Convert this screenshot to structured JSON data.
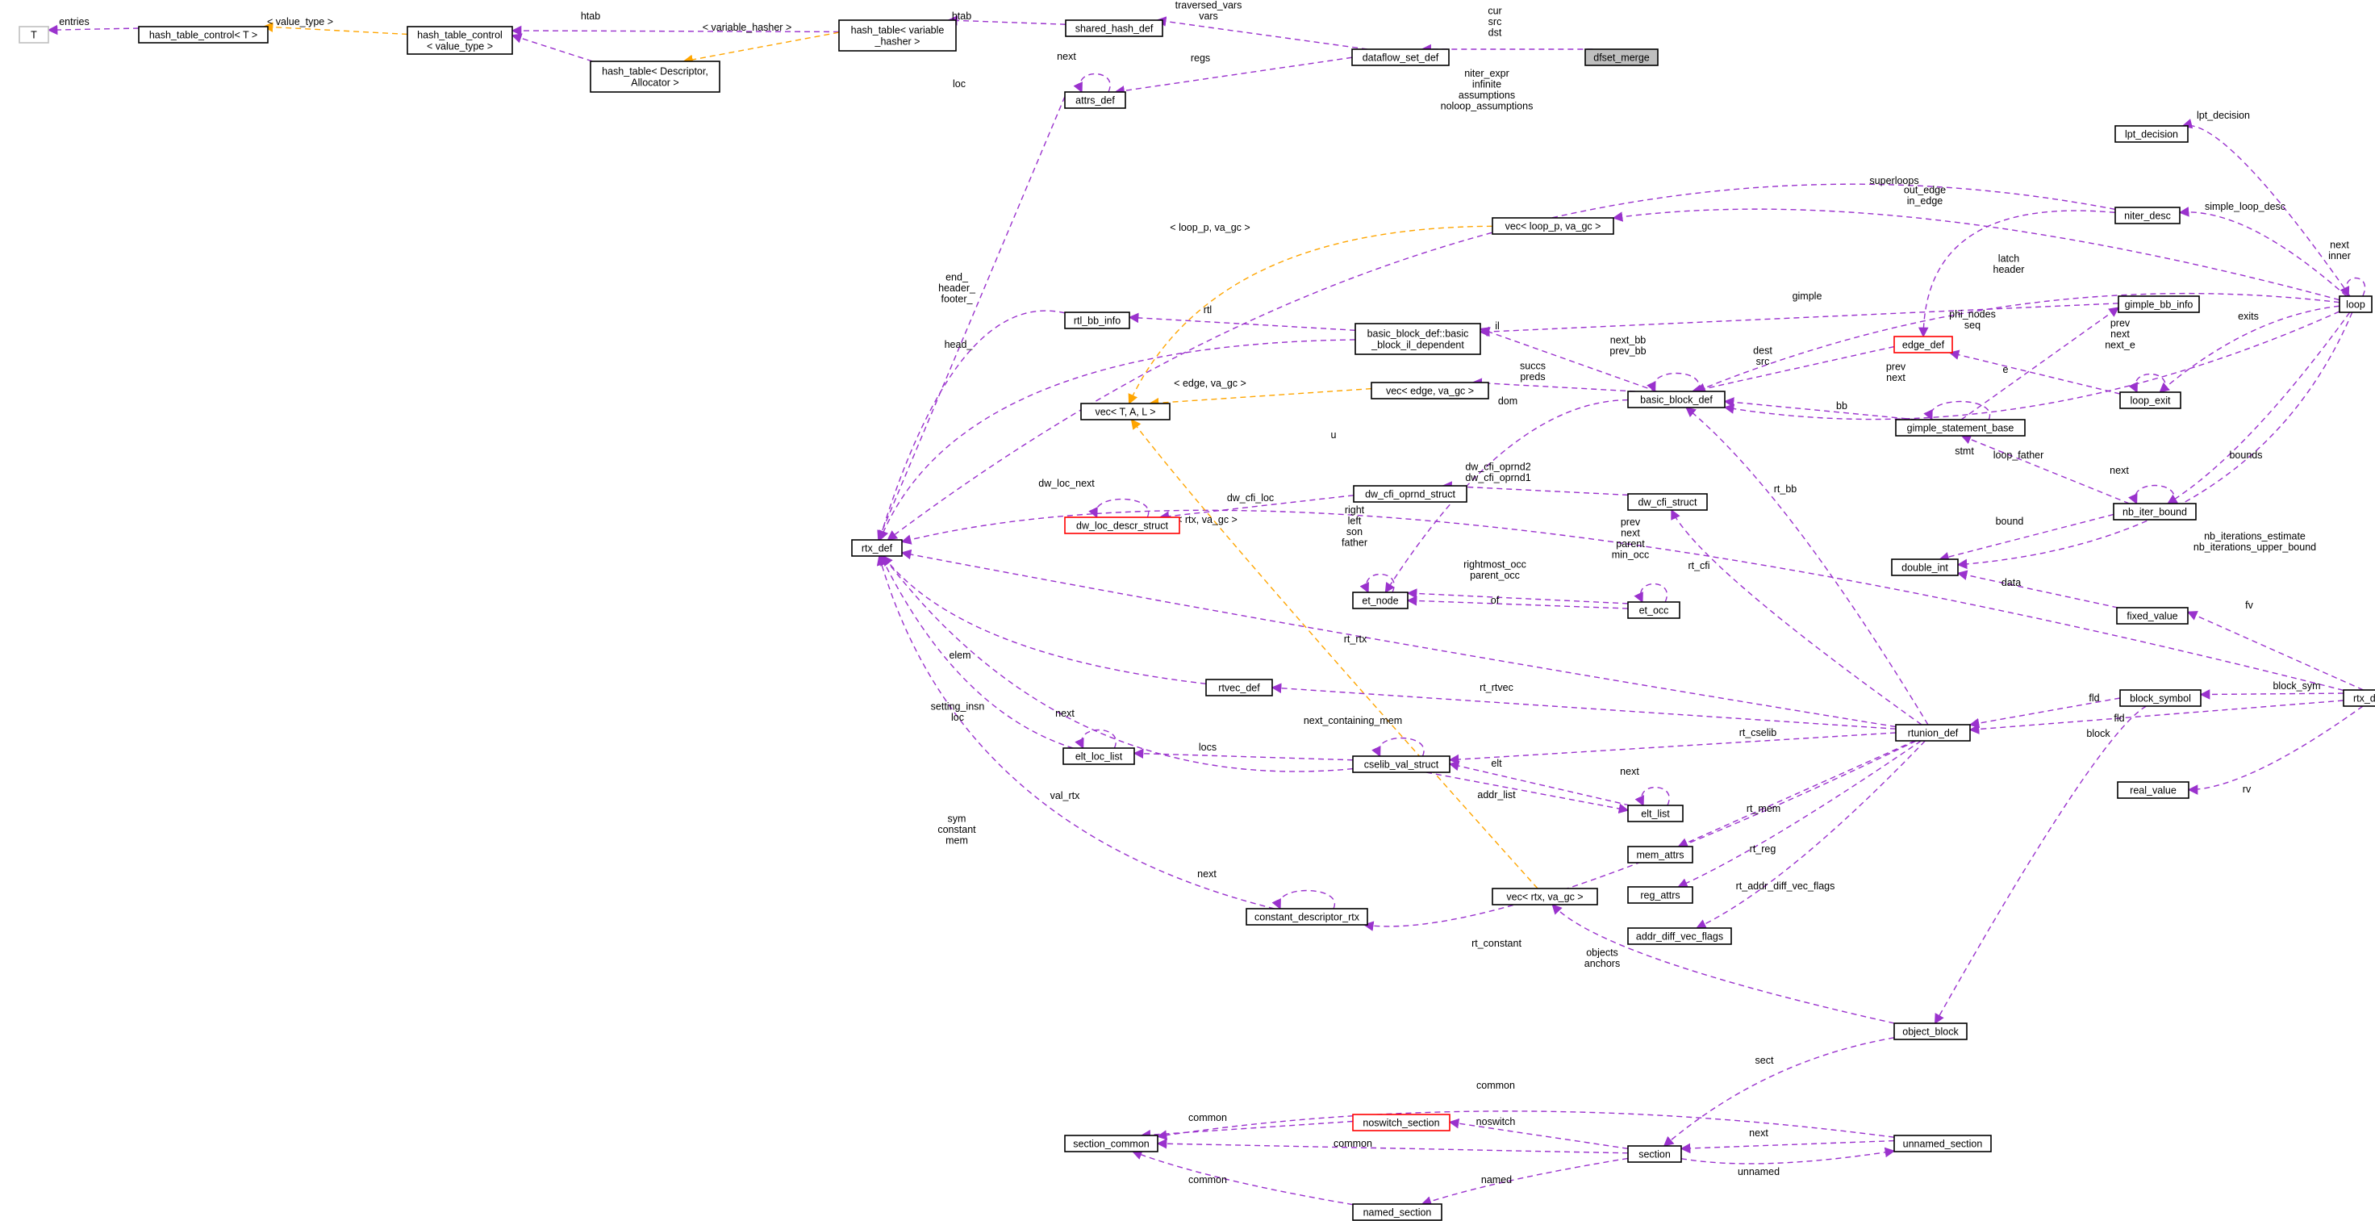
{
  "colors": {
    "composition": "#9a32cd",
    "template": "#ffa500",
    "node_border": "#000000",
    "highlight_border": "#ff0000",
    "root_fill": "#bfbfbf"
  },
  "nodes": [
    {
      "id": "T",
      "lines": [
        "T"
      ]
    },
    {
      "id": "htc_T",
      "lines": [
        "hash_table_control< T >"
      ]
    },
    {
      "id": "htc_vt",
      "lines": [
        "hash_table_control",
        "< value_type >"
      ]
    },
    {
      "id": "ht_vh",
      "lines": [
        "hash_table< variable",
        "_hasher >"
      ]
    },
    {
      "id": "ht_da",
      "lines": [
        "hash_table< Descriptor,",
        "Allocator >"
      ]
    },
    {
      "id": "shared_hash_def",
      "lines": [
        "shared_hash_def"
      ]
    },
    {
      "id": "dataflow_set_def",
      "lines": [
        "dataflow_set_def"
      ]
    },
    {
      "id": "dfset_merge",
      "lines": [
        "dfset_merge"
      ]
    },
    {
      "id": "attrs_def",
      "lines": [
        "attrs_def"
      ]
    },
    {
      "id": "lpt_decision",
      "lines": [
        "lpt_decision"
      ]
    },
    {
      "id": "vec_loop_p",
      "lines": [
        "vec< loop_p, va_gc >"
      ]
    },
    {
      "id": "niter_desc",
      "lines": [
        "niter_desc"
      ]
    },
    {
      "id": "rtl_bb_info",
      "lines": [
        "rtl_bb_info"
      ]
    },
    {
      "id": "bb_il_dep",
      "lines": [
        "basic_block_def::basic",
        "_block_il_dependent"
      ]
    },
    {
      "id": "gimple_bb_info",
      "lines": [
        "gimple_bb_info"
      ]
    },
    {
      "id": "loop",
      "lines": [
        "loop"
      ]
    },
    {
      "id": "edge_def",
      "lines": [
        "edge_def"
      ]
    },
    {
      "id": "vec_edge",
      "lines": [
        "vec< edge, va_gc >"
      ]
    },
    {
      "id": "basic_block_def",
      "lines": [
        "basic_block_def"
      ]
    },
    {
      "id": "vec_TAL",
      "lines": [
        "vec< T, A, L >"
      ]
    },
    {
      "id": "loop_exit",
      "lines": [
        "loop_exit"
      ]
    },
    {
      "id": "gimple_statement_base",
      "lines": [
        "gimple_statement_base"
      ]
    },
    {
      "id": "dw_cfi_oprnd_struct",
      "lines": [
        "dw_cfi_oprnd_struct"
      ]
    },
    {
      "id": "dw_cfi_struct",
      "lines": [
        "dw_cfi_struct"
      ]
    },
    {
      "id": "dw_loc_descr_struct",
      "lines": [
        "dw_loc_descr_struct"
      ]
    },
    {
      "id": "nb_iter_bound",
      "lines": [
        "nb_iter_bound"
      ]
    },
    {
      "id": "rtx_def",
      "lines": [
        "rtx_def"
      ]
    },
    {
      "id": "double_int",
      "lines": [
        "double_int"
      ]
    },
    {
      "id": "et_node",
      "lines": [
        "et_node"
      ]
    },
    {
      "id": "et_occ",
      "lines": [
        "et_occ"
      ]
    },
    {
      "id": "fixed_value",
      "lines": [
        "fixed_value"
      ]
    },
    {
      "id": "rtvec_def",
      "lines": [
        "rtvec_def"
      ]
    },
    {
      "id": "block_symbol",
      "lines": [
        "block_symbol"
      ]
    },
    {
      "id": "rtx_def_u",
      "lines": [
        "rtx_def::u"
      ]
    },
    {
      "id": "rtunion_def",
      "lines": [
        "rtunion_def"
      ]
    },
    {
      "id": "elt_loc_list",
      "lines": [
        "elt_loc_list"
      ]
    },
    {
      "id": "cselib_val_struct",
      "lines": [
        "cselib_val_struct"
      ]
    },
    {
      "id": "elt_list",
      "lines": [
        "elt_list"
      ]
    },
    {
      "id": "real_value",
      "lines": [
        "real_value"
      ]
    },
    {
      "id": "mem_attrs",
      "lines": [
        "mem_attrs"
      ]
    },
    {
      "id": "reg_attrs",
      "lines": [
        "reg_attrs"
      ]
    },
    {
      "id": "vec_rtx",
      "lines": [
        "vec< rtx, va_gc >"
      ]
    },
    {
      "id": "constant_descriptor_rtx",
      "lines": [
        "constant_descriptor_rtx"
      ]
    },
    {
      "id": "addr_diff_vec_flags",
      "lines": [
        "addr_diff_vec_flags"
      ]
    },
    {
      "id": "object_block",
      "lines": [
        "object_block"
      ]
    },
    {
      "id": "noswitch_section",
      "lines": [
        "noswitch_section"
      ]
    },
    {
      "id": "section_common",
      "lines": [
        "section_common"
      ]
    },
    {
      "id": "section",
      "lines": [
        "section"
      ]
    },
    {
      "id": "unnamed_section",
      "lines": [
        "unnamed_section"
      ]
    },
    {
      "id": "named_section",
      "lines": [
        "named_section"
      ]
    }
  ],
  "edges": [
    {
      "id": "e1",
      "lines": [
        "entries"
      ]
    },
    {
      "id": "e2",
      "lines": [
        "< value_type >"
      ]
    },
    {
      "id": "e3",
      "lines": [
        "htab"
      ]
    },
    {
      "id": "e4",
      "lines": [
        "htab"
      ]
    },
    {
      "id": "e5",
      "lines": [
        "< variable_hasher >"
      ]
    },
    {
      "id": "e6",
      "lines": [
        "htab"
      ]
    },
    {
      "id": "e7",
      "lines": [
        "traversed_vars",
        "vars"
      ]
    },
    {
      "id": "e8",
      "lines": [
        "cur",
        "src",
        "dst"
      ]
    },
    {
      "id": "e9",
      "lines": [
        "regs"
      ]
    },
    {
      "id": "e10",
      "lines": [
        "next"
      ]
    },
    {
      "id": "e11",
      "lines": [
        "loc"
      ]
    },
    {
      "id": "e12",
      "lines": [
        "niter_expr",
        "infinite",
        "assumptions",
        "noloop_assumptions"
      ]
    },
    {
      "id": "e13",
      "lines": [
        "lpt_decision"
      ]
    },
    {
      "id": "e14",
      "lines": [
        "superloops"
      ]
    },
    {
      "id": "e15",
      "lines": [
        "simple_loop_desc"
      ]
    },
    {
      "id": "e16",
      "lines": [
        "next",
        "inner"
      ]
    },
    {
      "id": "e17",
      "lines": [
        "< loop_p, va_gc >"
      ]
    },
    {
      "id": "e18",
      "lines": [
        "out_edge",
        "in_edge"
      ]
    },
    {
      "id": "e19",
      "lines": [
        "latch",
        "header"
      ]
    },
    {
      "id": "e20",
      "lines": [
        "gimple"
      ]
    },
    {
      "id": "e21",
      "lines": [
        "rtl"
      ]
    },
    {
      "id": "e22",
      "lines": [
        "end_",
        "header_",
        "footer_"
      ]
    },
    {
      "id": "e23",
      "lines": [
        "il"
      ]
    },
    {
      "id": "e24",
      "lines": [
        "head_"
      ]
    },
    {
      "id": "e25",
      "lines": [
        "exits"
      ]
    },
    {
      "id": "e26",
      "lines": [
        "phi_nodes",
        "seq"
      ]
    },
    {
      "id": "e27",
      "lines": [
        "dest",
        "src"
      ]
    },
    {
      "id": "e28",
      "lines": [
        "next_bb",
        "prev_bb"
      ]
    },
    {
      "id": "e29",
      "lines": [
        "succs",
        "preds"
      ]
    },
    {
      "id": "e30",
      "lines": [
        "< edge, va_gc >"
      ]
    },
    {
      "id": "e31",
      "lines": [
        "prev",
        "next"
      ]
    },
    {
      "id": "e32",
      "lines": [
        "prev",
        "next",
        "next_e"
      ]
    },
    {
      "id": "e33",
      "lines": [
        "e"
      ]
    },
    {
      "id": "e34",
      "lines": [
        "bb"
      ]
    },
    {
      "id": "e35",
      "lines": [
        "dom"
      ]
    },
    {
      "id": "e36",
      "lines": [
        "loop_father"
      ]
    },
    {
      "id": "e37",
      "lines": [
        "u"
      ]
    },
    {
      "id": "e38",
      "lines": [
        "stmt"
      ]
    },
    {
      "id": "e39",
      "lines": [
        "bounds"
      ]
    },
    {
      "id": "e40",
      "lines": [
        "next"
      ]
    },
    {
      "id": "e41",
      "lines": [
        "bound"
      ]
    },
    {
      "id": "e42",
      "lines": [
        "nb_iterations_estimate",
        "nb_iterations_upper_bound"
      ]
    },
    {
      "id": "e43",
      "lines": [
        "dw_cfi_oprnd2",
        "dw_cfi_oprnd1"
      ]
    },
    {
      "id": "e44",
      "lines": [
        "dw_cfi_loc"
      ]
    },
    {
      "id": "e45",
      "lines": [
        "dw_loc_next"
      ]
    },
    {
      "id": "e46",
      "lines": [
        "< rtx, va_gc >"
      ]
    },
    {
      "id": "e47",
      "lines": [
        "right",
        "left",
        "son",
        "father"
      ]
    },
    {
      "id": "e48",
      "lines": [
        "prev",
        "next",
        "parent",
        "min_occ"
      ]
    },
    {
      "id": "e49",
      "lines": [
        "rightmost_occ",
        "parent_occ"
      ]
    },
    {
      "id": "e50",
      "lines": [
        "of"
      ]
    },
    {
      "id": "e51",
      "lines": [
        "rt_bb"
      ]
    },
    {
      "id": "e52",
      "lines": [
        "rt_cfi"
      ]
    },
    {
      "id": "e53",
      "lines": [
        "rt_rtx"
      ]
    },
    {
      "id": "e54",
      "lines": [
        "data"
      ]
    },
    {
      "id": "e55",
      "lines": [
        "fv"
      ]
    },
    {
      "id": "e56",
      "lines": [
        "elem"
      ]
    },
    {
      "id": "e57",
      "lines": [
        "rt_rtvec"
      ]
    },
    {
      "id": "e58",
      "lines": [
        "fld"
      ]
    },
    {
      "id": "e59",
      "lines": [
        "block_sym"
      ]
    },
    {
      "id": "e60",
      "lines": [
        "fld"
      ]
    },
    {
      "id": "e61",
      "lines": [
        "setting_insn",
        "loc"
      ]
    },
    {
      "id": "e62",
      "lines": [
        "next"
      ]
    },
    {
      "id": "e63",
      "lines": [
        "next_containing_mem"
      ]
    },
    {
      "id": "e64",
      "lines": [
        "locs"
      ]
    },
    {
      "id": "e65",
      "lines": [
        "rt_cselib"
      ]
    },
    {
      "id": "e66",
      "lines": [
        "block"
      ]
    },
    {
      "id": "e67",
      "lines": [
        "rv"
      ]
    },
    {
      "id": "e68",
      "lines": [
        "next"
      ]
    },
    {
      "id": "e69",
      "lines": [
        "elt"
      ]
    },
    {
      "id": "e70",
      "lines": [
        "val_rtx"
      ]
    },
    {
      "id": "e71",
      "lines": [
        "addr_list"
      ]
    },
    {
      "id": "e72",
      "lines": [
        "rt_mem"
      ]
    },
    {
      "id": "e73",
      "lines": [
        "sym",
        "constant",
        "mem"
      ]
    },
    {
      "id": "e74",
      "lines": [
        "rt_reg"
      ]
    },
    {
      "id": "e75",
      "lines": [
        "next"
      ]
    },
    {
      "id": "e76",
      "lines": [
        "rt_addr_diff_vec_flags"
      ]
    },
    {
      "id": "e77",
      "lines": [
        "rt_constant"
      ]
    },
    {
      "id": "e78",
      "lines": [
        "objects",
        "anchors"
      ]
    },
    {
      "id": "e79",
      "lines": [
        "sect"
      ]
    },
    {
      "id": "e80",
      "lines": [
        "common"
      ]
    },
    {
      "id": "e81",
      "lines": [
        "common"
      ]
    },
    {
      "id": "e82",
      "lines": [
        "noswitch"
      ]
    },
    {
      "id": "e83",
      "lines": [
        "common"
      ]
    },
    {
      "id": "e84",
      "lines": [
        "next"
      ]
    },
    {
      "id": "e85",
      "lines": [
        "unnamed"
      ]
    },
    {
      "id": "e86",
      "lines": [
        "common"
      ]
    },
    {
      "id": "e87",
      "lines": [
        "named"
      ]
    }
  ]
}
